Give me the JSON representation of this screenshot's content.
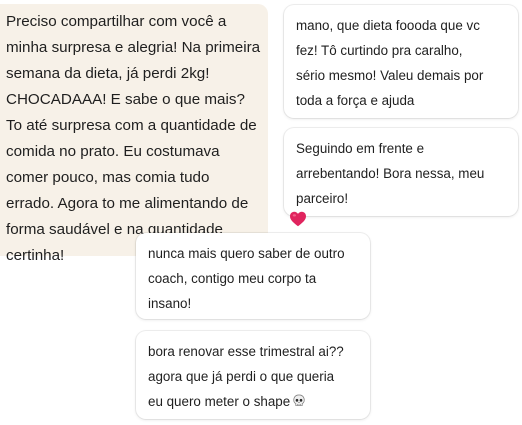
{
  "messages": [
    {
      "id": "msg-1",
      "text": " Preciso compartilhar com você a\nminha surpresa e alegria! Na primeira\nsemana da dieta, já perdi 2kg!\nCHOCADAAA! E sabe o que mais?\nTo até surpresa com a quantidade de\ncomida no prato. Eu costumava\ncomer pouco, mas comia tudo\nerrado. Agora to me alimentando de\nforma saudável e na quantidade\ncertinha!"
    },
    {
      "id": "msg-2",
      "text": "mano, que dieta foooda que vc\nfez! Tô curtindo pra caralho,\nsério mesmo! Valeu demais por\ntoda a força e ajuda"
    },
    {
      "id": "msg-3",
      "text": "Seguindo em frente e\narrebentando! Bora nessa, meu\nparceiro!",
      "reaction_icon": "red-heart-icon"
    },
    {
      "id": "msg-4",
      "text": "nunca mais quero saber de outro\ncoach, contigo meu corpo ta\ninsano!"
    },
    {
      "id": "msg-5",
      "text": "bora renovar esse trimestral ai??\nagora que já perdi o que queria\neu quero meter o shape",
      "trailing_icon": "skull-icon"
    }
  ],
  "colors": {
    "beige_bubble": "#f7f1e8",
    "white_bubble": "#ffffff",
    "heart": "#e0245e",
    "text": "#1f1f1f"
  }
}
